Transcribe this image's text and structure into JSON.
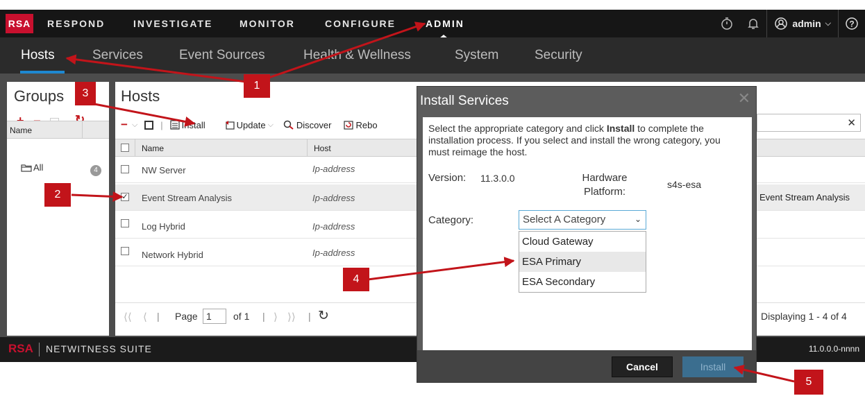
{
  "top_nav": {
    "logo": "RSA",
    "items": [
      "RESPOND",
      "INVESTIGATE",
      "MONITOR",
      "CONFIGURE",
      "ADMIN"
    ],
    "active": "ADMIN",
    "user": "admin"
  },
  "sub_nav": {
    "items": [
      "Hosts",
      "Services",
      "Event Sources",
      "Health & Wellness",
      "System",
      "Security"
    ],
    "active": "Hosts"
  },
  "groups_panel": {
    "title": "Groups",
    "column_name": "Name",
    "item_label": "All",
    "item_count": "4"
  },
  "hosts_panel": {
    "title": "Hosts",
    "toolbar": {
      "install": "Install",
      "update": "Update",
      "discover": "Discover",
      "reboot_partial": "Rebo"
    },
    "columns": [
      "Name",
      "Host"
    ],
    "rows": [
      {
        "name": "NW Server",
        "host": "Ip-address",
        "checked": false
      },
      {
        "name": "Event Stream Analysis",
        "host": "Ip-address",
        "checked": true,
        "services": "- Event Stream Analysis"
      },
      {
        "name": "Log Hybrid",
        "host": "Ip-address",
        "checked": false
      },
      {
        "name": "Network Hybrid",
        "host": "Ip-address",
        "checked": false
      }
    ],
    "pager": {
      "page_label": "Page",
      "page_value": "1",
      "of_label": "of 1",
      "displaying": "Displaying 1 - 4 of 4"
    }
  },
  "footer": {
    "brand": "RSA",
    "suite": "NETWITNESS SUITE",
    "version": "11.0.0.0-nnnn"
  },
  "modal": {
    "title": "Install Services",
    "instructions_part1": "Select the appropriate category and click ",
    "instructions_bold": "Install",
    "instructions_part2": " to complete the installation process. If you select and install the wrong category, you must reimage the host.",
    "version_label": "Version:",
    "version_value": "11.3.0.0",
    "hardware_label": "Hardware Platform:",
    "hardware_value": "s4s-esa",
    "category_label": "Category:",
    "category_placeholder": "Select A Category",
    "category_options": [
      "Cloud Gateway",
      "ESA Primary",
      "ESA Secondary"
    ],
    "highlighted_option": "ESA Primary",
    "cancel": "Cancel",
    "install": "Install"
  },
  "callouts": [
    "1",
    "2",
    "3",
    "4",
    "5"
  ],
  "colors": {
    "callout_red": "#c2141a",
    "logo_red": "#c8102e",
    "active_underline": "#1e88d1",
    "nav_bg": "#161616"
  }
}
